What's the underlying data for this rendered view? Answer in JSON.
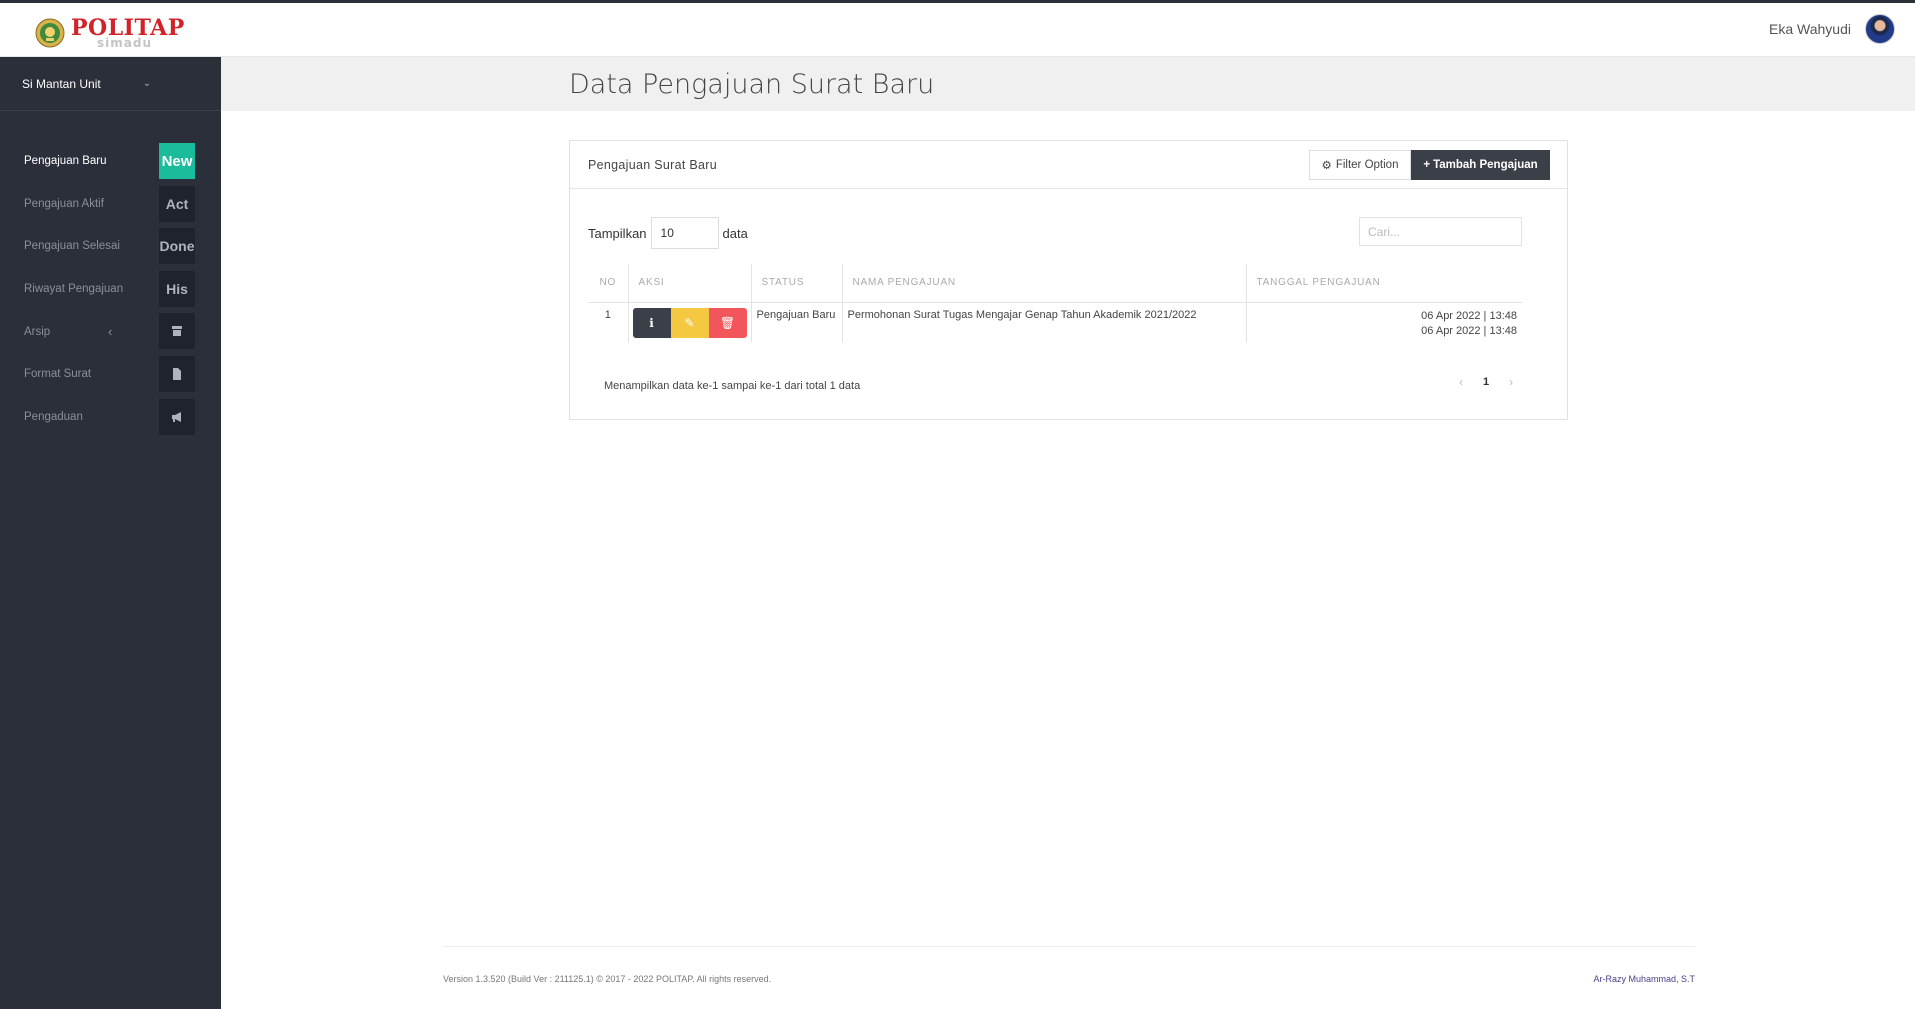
{
  "brand": {
    "name": "POLITAP",
    "sub": "simadu"
  },
  "user": {
    "name": "Eka Wahyudi"
  },
  "sidebar": {
    "unit": "Si Mantan Unit",
    "items": [
      {
        "label": "Pengajuan Baru",
        "badge": "New",
        "icon": ""
      },
      {
        "label": "Pengajuan Aktif",
        "badge": "Act",
        "icon": ""
      },
      {
        "label": "Pengajuan Selesai",
        "badge": "Done",
        "icon": ""
      },
      {
        "label": "Riwayat Pengajuan",
        "badge": "His",
        "icon": ""
      },
      {
        "label": "Arsip",
        "badge": "",
        "icon": "archive-icon"
      },
      {
        "label": "Format Surat",
        "badge": "",
        "icon": "file-icon"
      },
      {
        "label": "Pengaduan",
        "badge": "",
        "icon": "bullhorn-icon"
      }
    ]
  },
  "page": {
    "title": "Data Pengajuan Surat Baru"
  },
  "panel": {
    "title": "Pengajuan Surat Baru",
    "filter_label": "Filter Option",
    "add_label": "Tambah Pengajuan",
    "length_prefix": "Tampilkan",
    "length_value": "10",
    "length_suffix": "data",
    "search_placeholder": "Cari..."
  },
  "table": {
    "headers": [
      "NO",
      "AKSI",
      "STATUS",
      "NAMA PENGAJUAN",
      "TANGGAL PENGAJUAN"
    ],
    "rows": [
      {
        "no": "1",
        "status": "Pengajuan Baru",
        "nama": "Permohonan Surat Tugas Mengajar Genap Tahun Akademik 2021/2022",
        "tanggal1": "06 Apr 2022 | 13:48",
        "tanggal2": "06 Apr 2022 | 13:48"
      }
    ]
  },
  "table_info": "Menampilkan data ke-1 sampai ke-1 dari total 1 data",
  "pagination": {
    "prev": "‹",
    "current": "1",
    "next": "›"
  },
  "footer": {
    "left": "Version 1.3.520 (Build Ver : 211125.1) © 2017 - 2022 POLITAP. All rights reserved.",
    "right": "Ar-Razy Muhammad, S.T"
  },
  "colors": {
    "sidebar": "#2b2f3a",
    "active_badge": "#1abc9c",
    "dark_button": "#3a3f48",
    "edit": "#f5c842",
    "delete": "#f2565a"
  }
}
